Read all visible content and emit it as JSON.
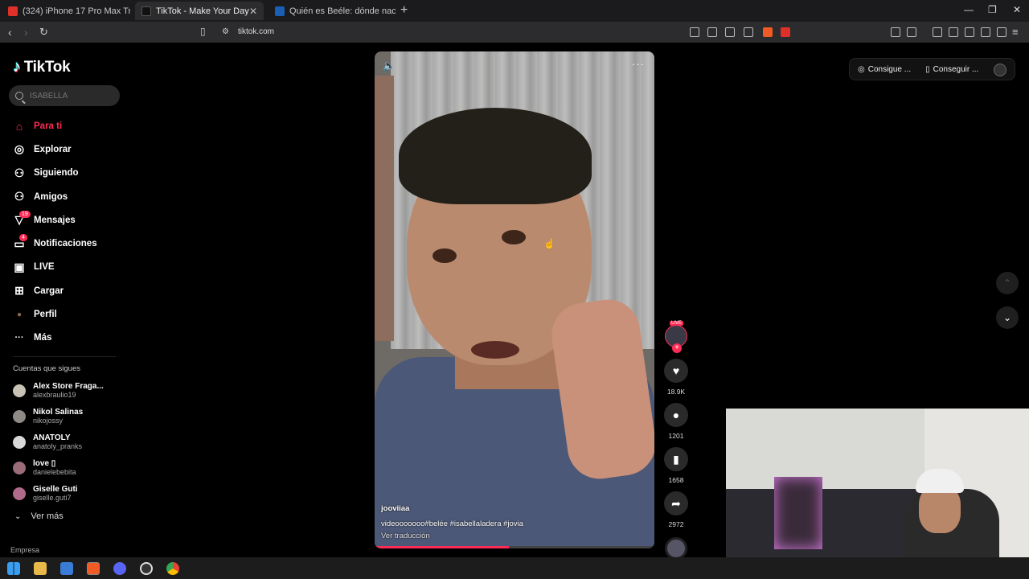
{
  "browser": {
    "tabs": [
      {
        "title": "(324) iPhone 17 Pro Max Trailer Look",
        "color": "#e0302a"
      },
      {
        "title": "TikTok - Make Your Day",
        "color": "#111111"
      },
      {
        "title": "Quién es Beéle: dónde nació, estatura",
        "color": "#1a5fb4"
      }
    ],
    "new_tab": "+",
    "url": "tiktok.com",
    "window": {
      "minimize": "—",
      "restore": "❐",
      "close": "✕"
    }
  },
  "sidebar": {
    "logo": "TikTok",
    "search_placeholder": "ISABELLA",
    "nav": [
      {
        "label": "Para ti",
        "icon": "⌂",
        "active": true
      },
      {
        "label": "Explorar",
        "icon": "◎"
      },
      {
        "label": "Siguiendo",
        "icon": "⚇"
      },
      {
        "label": "Amigos",
        "icon": "⚇"
      },
      {
        "label": "Mensajes",
        "icon": "▽",
        "badge": "19"
      },
      {
        "label": "Notificaciones",
        "icon": "▭",
        "badge": "4"
      },
      {
        "label": "LIVE",
        "icon": "▣"
      },
      {
        "label": "Cargar",
        "icon": "⊞"
      },
      {
        "label": "Perfil",
        "icon": "●"
      },
      {
        "label": "Más",
        "icon": "···"
      }
    ],
    "following_title": "Cuentas que sigues",
    "following": [
      {
        "name": "Alex Store Fraga...",
        "user": "alexbraulio19",
        "color": "#c9c3b5"
      },
      {
        "name": "Nikol Salinas",
        "user": "nikojossy",
        "color": "#8e8a86"
      },
      {
        "name": "ANATOLY",
        "user": "anatoly_pranks",
        "color": "#d8d8d8"
      },
      {
        "name": "love ▯",
        "user": "danielebebita",
        "color": "#9a6c78"
      },
      {
        "name": "Giselle Guti",
        "user": "giselle.guti7",
        "color": "#b06a8a"
      }
    ],
    "see_more": "Ver más",
    "footer": "Empresa"
  },
  "video": {
    "author": "jooviiaa",
    "caption": "videooooooo#belée  #isabellaladera  #jovia",
    "translate": "Ver traducción",
    "progress": 0.48
  },
  "actions": {
    "live_label": "LIVE",
    "likes": "18.9K",
    "comments": "1201",
    "saves": "1658",
    "shares": "2972"
  },
  "topright": {
    "coins_label": "Consigue ...",
    "app_label": "Conseguir ..."
  }
}
